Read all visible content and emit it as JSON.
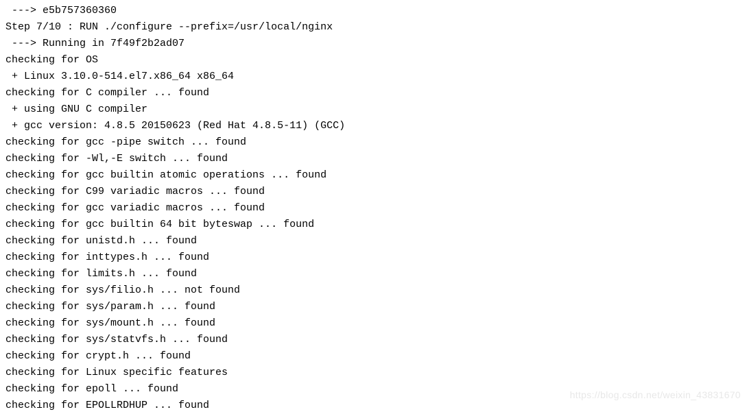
{
  "terminal": {
    "lines": [
      " ---> e5b757360360",
      "Step 7/10 : RUN ./configure --prefix=/usr/local/nginx",
      " ---> Running in 7f49f2b2ad07",
      "checking for OS",
      " + Linux 3.10.0-514.el7.x86_64 x86_64",
      "checking for C compiler ... found",
      " + using GNU C compiler",
      " + gcc version: 4.8.5 20150623 (Red Hat 4.8.5-11) (GCC)",
      "checking for gcc -pipe switch ... found",
      "checking for -Wl,-E switch ... found",
      "checking for gcc builtin atomic operations ... found",
      "checking for C99 variadic macros ... found",
      "checking for gcc variadic macros ... found",
      "checking for gcc builtin 64 bit byteswap ... found",
      "checking for unistd.h ... found",
      "checking for inttypes.h ... found",
      "checking for limits.h ... found",
      "checking for sys/filio.h ... not found",
      "checking for sys/param.h ... found",
      "checking for sys/mount.h ... found",
      "checking for sys/statvfs.h ... found",
      "checking for crypt.h ... found",
      "checking for Linux specific features",
      "checking for epoll ... found",
      "checking for EPOLLRDHUP ... found"
    ]
  },
  "watermark": {
    "text": "https://blog.csdn.net/weixin_43831670"
  }
}
